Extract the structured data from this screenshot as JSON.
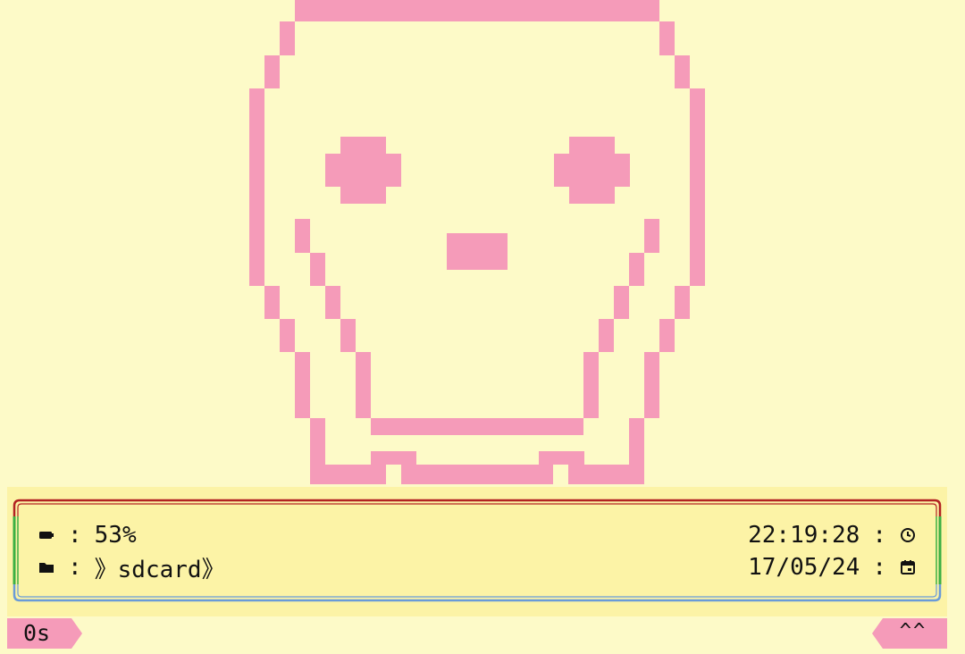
{
  "art": {
    "name": "pixel-skull",
    "color": "#f59bb9"
  },
  "status": {
    "battery_percent": 53,
    "battery_text": "53%",
    "folder_path": "》sdcard》",
    "time": "22:19:28",
    "date": "17/05/24",
    "separator": ":",
    "icons": {
      "battery": "battery-icon",
      "folder": "folder-icon",
      "clock": "clock-icon",
      "calendar": "calendar-icon"
    }
  },
  "frame_colors": {
    "top": "#b22222",
    "sides": "#3cb043",
    "bottom": "#6a9bd8",
    "background": "#fcf3a6"
  },
  "footer": {
    "prompt_label": "0s",
    "scroll_label": "^^"
  }
}
